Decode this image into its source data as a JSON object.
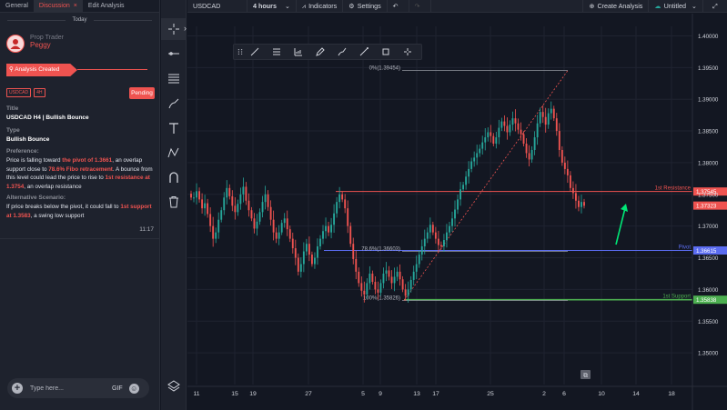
{
  "left_panel": {
    "tabs": [
      {
        "label": "General"
      },
      {
        "label": "Discussion"
      },
      {
        "label": "Edit Analysis"
      }
    ],
    "close_glyph": "×",
    "today": "Today",
    "author": {
      "role": "Prop Trader",
      "name": "Peggy",
      "avatar_icon": "user-avatar"
    },
    "created_label": "Analysis Created",
    "badges": [
      "USDCAD",
      "4H"
    ],
    "status": "Pending",
    "title_label": "Title",
    "title_value": "USDCAD H4 | Bullish Bounce",
    "type_label": "Type",
    "type_value": "Bullish Bounce",
    "preference_label": "Preference:",
    "preference": {
      "t1": "Price is falling toward ",
      "h1": "the pivot of 1.3661",
      "t2": ", an overlap support close to ",
      "h2": "78.6% Fibo retracement",
      "t3": ". A bounce from this level could lead the price to rise to ",
      "h3": "1st resistance at 1.3754",
      "t4": ", an overlap resistance"
    },
    "alt_label": "Alternative Scenario:",
    "alternative": {
      "t1": "If price breaks below the pivot, it could fall to ",
      "h1": "1st support at 1.3583",
      "t2": ", a swing low support"
    },
    "time": "11:17",
    "composer": {
      "placeholder": "Type here...",
      "gif": "GIF"
    }
  },
  "toolbar": {
    "tools": [
      "crosshair-icon",
      "horizontal-line-icon",
      "fib-retracement-icon",
      "brush-icon",
      "text-icon",
      "pattern-icon",
      "magnet-icon",
      "trash-icon"
    ],
    "bottom_tool": "layers-icon",
    "collapse_glyph": "›"
  },
  "topbar": {
    "symbol": "USDCAD",
    "interval": "4 hours",
    "indicators": "Indicators",
    "settings": "Settings",
    "create_analysis": "Create Analysis",
    "layout_name": "Untitled"
  },
  "colors": {
    "up": "#26a69a",
    "down": "#ef5350",
    "resistance": "#ef5350",
    "pivot": "#5b6cf0",
    "support": "#4caf50",
    "fib": "#9598a1"
  },
  "chart_data": {
    "type": "candlestick",
    "symbol": "USDCAD",
    "interval": "4 hours",
    "ylim": [
      1.345,
      1.4015
    ],
    "y_ticks": [
      "1.40000",
      "1.39500",
      "1.39000",
      "1.38500",
      "1.38000",
      "1.37500",
      "1.37000",
      "1.36500",
      "1.36000",
      "1.35500",
      "1.35000"
    ],
    "x_ticks": [
      "11",
      "15",
      "19",
      "27",
      "5",
      "9",
      "13",
      "17",
      "25",
      "2",
      "6",
      "10",
      "14",
      "18"
    ],
    "levels": [
      {
        "name": "1st Resistance",
        "value": 1.37545,
        "label": "1.37545"
      },
      {
        "name": "Pivot",
        "value": 1.36615,
        "label": "1.36615"
      },
      {
        "name": "1st Support",
        "value": 1.35838,
        "label": "1.35838"
      }
    ],
    "last_price": {
      "value": 1.37323,
      "label": "1.37323"
    },
    "fibonacci": {
      "top": {
        "ratio": "0%",
        "value": 1.39454,
        "label": "0%(1.39454)"
      },
      "mid": {
        "ratio": "78.6%",
        "value": 1.36603,
        "label": "78.6%(1.36603)"
      },
      "bottom": {
        "ratio": "100%",
        "value": 1.35826,
        "label": "100%(1.35826)"
      }
    },
    "path_closes": [
      1.3745,
      1.3745,
      1.3755,
      1.3742,
      1.3728,
      1.3736,
      1.3719,
      1.37,
      1.368,
      1.369,
      1.371,
      1.3725,
      1.3745,
      1.376,
      1.3747,
      1.3732,
      1.3722,
      1.3735,
      1.375,
      1.3762,
      1.374,
      1.3725,
      1.3712,
      1.3696,
      1.3707,
      1.3722,
      1.3738,
      1.375,
      1.373,
      1.371,
      1.369,
      1.368,
      1.369,
      1.3705,
      1.3712,
      1.3695,
      1.368,
      1.3665,
      1.365,
      1.3628,
      1.364,
      1.366,
      1.3672,
      1.3655,
      1.364,
      1.365,
      1.3668,
      1.368,
      1.3692,
      1.37,
      1.369,
      1.3702,
      1.372,
      1.3738,
      1.375,
      1.3742,
      1.3728,
      1.37,
      1.3672,
      1.3648,
      1.3628,
      1.361,
      1.3598,
      1.3592,
      1.361,
      1.3625,
      1.3612,
      1.36,
      1.3595,
      1.361,
      1.3625,
      1.363,
      1.362,
      1.361,
      1.362,
      1.3628,
      1.3616,
      1.36,
      1.359,
      1.36,
      1.3615,
      1.3628,
      1.364,
      1.3655,
      1.3668,
      1.368,
      1.369,
      1.3702,
      1.369,
      1.368,
      1.367,
      1.3668,
      1.3678,
      1.369,
      1.37,
      1.3712,
      1.3726,
      1.3742,
      1.3758,
      1.3765,
      1.3778,
      1.379,
      1.3802,
      1.3808,
      1.3815,
      1.3822,
      1.3832,
      1.384,
      1.3848,
      1.3842,
      1.383,
      1.384,
      1.3855,
      1.3865,
      1.3858,
      1.3848,
      1.386,
      1.387,
      1.3862,
      1.3852,
      1.3845,
      1.383,
      1.3815,
      1.3805,
      1.382,
      1.384,
      1.3862,
      1.388,
      1.3872,
      1.386,
      1.3878,
      1.3885,
      1.387,
      1.385,
      1.382,
      1.38,
      1.379,
      1.378,
      1.376,
      1.3752,
      1.374,
      1.373,
      1.3738,
      1.3732
    ]
  }
}
